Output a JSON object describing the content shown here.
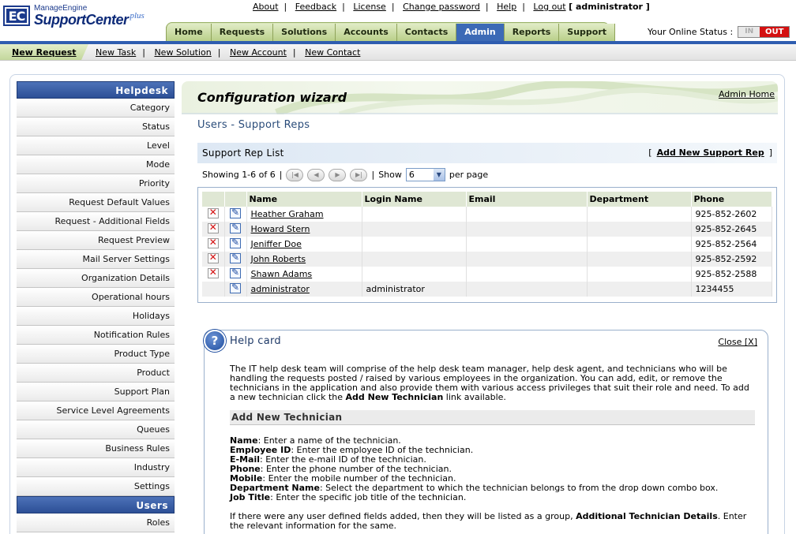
{
  "logo": {
    "mark": "EC",
    "brand_small": "ManageEngine",
    "brand_big": "SupportCenter",
    "brand_plus": "plus"
  },
  "top_links": [
    "About",
    "Feedback",
    "License",
    "Change password",
    "Help",
    "Log out"
  ],
  "current_user": "[ administrator ]",
  "tabs": [
    {
      "label": "Home",
      "active": false
    },
    {
      "label": "Requests",
      "active": false
    },
    {
      "label": "Solutions",
      "active": false
    },
    {
      "label": "Accounts",
      "active": false
    },
    {
      "label": "Contacts",
      "active": false
    },
    {
      "label": "Admin",
      "active": true
    },
    {
      "label": "Reports",
      "active": false
    },
    {
      "label": "Support",
      "active": false
    }
  ],
  "online_status": {
    "label": "Your Online Status :",
    "in": "IN",
    "out": "OUT"
  },
  "subnav": {
    "first": "New Request",
    "links": [
      "New Task",
      "New Solution",
      "New Account",
      "New Contact"
    ]
  },
  "sidebar": {
    "helpdesk_title": "Helpdesk",
    "helpdesk_items": [
      "Category",
      "Status",
      "Level",
      "Mode",
      "Priority",
      "Request Default Values",
      "Request - Additional Fields",
      "Request Preview",
      "Mail Server Settings",
      "Organization Details",
      "Operational hours",
      "Holidays",
      "Notification Rules",
      "Product Type",
      "Product",
      "Support Plan",
      "Service Level Agreements",
      "Queues",
      "Business Rules",
      "Industry",
      "Settings"
    ],
    "users_title": "Users",
    "users_items": [
      "Roles"
    ]
  },
  "main": {
    "wizard_title": "Configuration wizard",
    "admin_home": "Admin Home",
    "section_title": "Users - Support Reps",
    "list_title": "Support Rep List",
    "add_new": "Add New Support Rep",
    "bracket_open": "[",
    "bracket_close": "]",
    "showing": "Showing 1-6 of 6",
    "pipe": "|",
    "show_label": "Show",
    "per_page_value": "6",
    "per_page_label": "per page"
  },
  "table": {
    "columns": [
      "Name",
      "Login Name",
      "Email",
      "Department",
      "Phone"
    ],
    "rows": [
      {
        "name": "Heather Graham",
        "login": "",
        "email": "",
        "department": "",
        "phone": "925-852-2602",
        "deletable": true
      },
      {
        "name": "Howard Stern",
        "login": "",
        "email": "",
        "department": "",
        "phone": "925-852-2645",
        "deletable": true
      },
      {
        "name": "Jeniffer Doe",
        "login": "",
        "email": "",
        "department": "",
        "phone": "925-852-2564",
        "deletable": true
      },
      {
        "name": "John Roberts",
        "login": "",
        "email": "",
        "department": "",
        "phone": "925-852-2592",
        "deletable": true
      },
      {
        "name": "Shawn Adams",
        "login": "",
        "email": "",
        "department": "",
        "phone": "925-852-2588",
        "deletable": true
      },
      {
        "name": "administrator",
        "login": "administrator",
        "email": "",
        "department": "",
        "phone": "1234455",
        "deletable": false
      }
    ]
  },
  "help": {
    "icon": "?",
    "title": "Help card",
    "close": "Close [X]",
    "intro_a": "The IT help desk team will comprise of the help desk team manager, help desk agent, and technicians who will be handling the requests posted / raised by various employees in the organization. You can add, edit, or remove the technicians in the application and also provide them with various access privileges that suit their role and need. To add a new technician click the ",
    "intro_bold": "Add New Technician",
    "intro_b": " link available.",
    "subtitle": "Add New Technician",
    "defs": [
      {
        "term": "Name",
        "text": ": Enter a name of the technician."
      },
      {
        "term": "Employee ID",
        "text": ": Enter the employee ID of the technician."
      },
      {
        "term": "E-Mail",
        "text": ": Enter the e-mail ID of the technician."
      },
      {
        "term": "Phone",
        "text": ": Enter the phone number of the technician."
      },
      {
        "term": "Mobile",
        "text": ": Enter the mobile number of the technician."
      },
      {
        "term": "Department Name",
        "text": ": Select the department to which the technician belongs to from the drop down combo box."
      },
      {
        "term": "Job Title",
        "text": ": Enter the specific job title of the technician."
      }
    ],
    "outro_a": "If there were any user defined fields added, then they will be listed as a group, ",
    "outro_bold": "Additional Technician Details",
    "outro_b": ". Enter the relevant information for the same."
  },
  "colors": {
    "brand_blue": "#2f5db0",
    "tab_green": "#c3d79c",
    "active_tab": "#3c6ab6",
    "out_red": "#d41010"
  }
}
